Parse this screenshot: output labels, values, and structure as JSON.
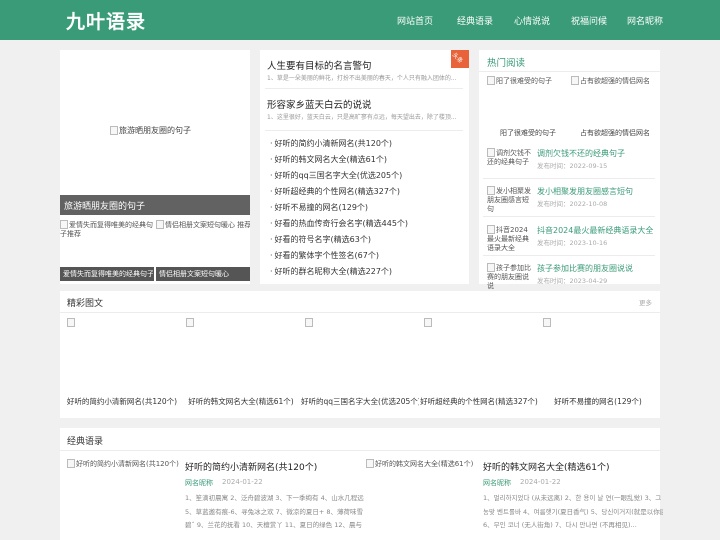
{
  "site": {
    "logo": "九叶语录",
    "nav": [
      "网站首页",
      "经典语录",
      "心情说说",
      "祝福问候",
      "网名昵称"
    ]
  },
  "slider": {
    "main_alt": "旅游晒朋友圈的句子",
    "main_caption": "旅游晒朋友圈的句子",
    "thumbs": [
      {
        "alt": "爱情失而复得唯美的经典句子推荐",
        "caption": "爱情失而复得唯美的经典句子"
      },
      {
        "alt": "情侣相册文案短句暖心",
        "caption": "情侣相册文案短句暖心 推荐",
        "label": "情侣相册文案短句暖心"
      }
    ]
  },
  "badge": "头条",
  "articles": [
    {
      "title": "人生要有目标的名言警句",
      "excerpt": "1、草是一朵美丽的鲜花，打扮不出美丽的春天，个人只有融入团体的..."
    },
    {
      "title": "形容家乡蓝天白云的说说",
      "excerpt": "1、这里很好，蓝天白云，只是高旷寥有点远，每天望出去，除了楼顶..."
    }
  ],
  "list": [
    "好听的简约小清新网名(共120个)",
    "好听的韩文网名大全(精选61个)",
    "好听的qq三国名字大全(优选205个)",
    "好听超经典的个性网名(精选327个)",
    "好听不易撞的网名(129个)",
    "好看的热血传奇行会名字(精选445个)",
    "好看的符号名字(精选63个)",
    "好看的繁体字个性签名(67个)",
    "好听的群名昵称大全(精选227个)"
  ],
  "hot": {
    "title": "热门阅读",
    "top": [
      {
        "alt": "阳了很难受的句子",
        "caption": "阳了很难受的句子"
      },
      {
        "alt": "占有欲超强的情侣网名",
        "caption": "占有欲超强的情侣网名"
      }
    ],
    "items": [
      {
        "alt": "调剂欠钱不还的经典句子",
        "title": "调剂欠钱不还的经典句子",
        "date": "发布时间：2022-09-15"
      },
      {
        "alt": "发小相聚发朋友圈感言短句",
        "title": "发小相聚发朋友圈感言短句",
        "date": "发布时间：2022-10-08"
      },
      {
        "alt": "抖音2024最火最新经典语录大全",
        "title": "抖音2024最火最新经典语录大全",
        "date": "发布时间：2023-10-16"
      },
      {
        "alt": "孩子参加比赛的朋友圈说说",
        "title": "孩子参加比赛的朋友圈说说",
        "date": "发布时间：2023-04-29"
      }
    ]
  },
  "featured": {
    "title": "精彩图文",
    "more": "更多",
    "items": [
      "好听的简约小清新网名(共120个)",
      "好听的韩文网名大全(精选61个)",
      "好听的qq三国名字大全(优选205个)",
      "好听超经典的个性网名(精选327个)",
      "好听不易撞的网名(129个)"
    ]
  },
  "classic": {
    "title": "经典语录",
    "items": [
      {
        "alt": "好听的简约小清新网名(共120个)",
        "title": "好听的简约小清新网名(共120个)",
        "category": "网名昵称",
        "date": "2024-01-22",
        "lines": [
          "1、笙滴初晨寓 2、泛舟碧波湖 3、下一季绚有 4、山水几程远",
          "5、草蓝邀有痕-6、寻兔冰之欢 7、微凉的夏日+ 8、薄荷味雪",
          "碧ˆ 9、兰花的抚看 10、天檀赏丫 11、夏日的绿色 12、晨与"
        ]
      },
      {
        "alt": "好听的韩文网名大全(精选61个)",
        "title": "好听的韩文网名大全(精选61个)",
        "category": "网名昵称",
        "date": "2024-01-22",
        "lines": [
          "1、멀리하지었다 (从未远离) 2、한 용이 날 연(一眼乱觉) 3、그 미",
          "농맞 벤트롤바 4、여름햇기(夏日香气) 5、당신이거지(就是以你底)",
          "6、무인 코너 (无人街角) 7、다시 만나면 (不再相见)..."
        ]
      }
    ]
  }
}
